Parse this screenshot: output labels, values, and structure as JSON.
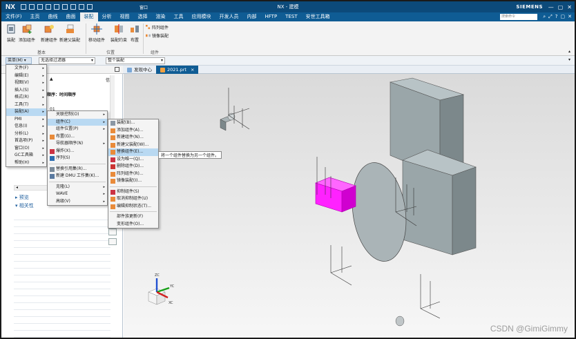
{
  "titlebar": {
    "logo": "NX",
    "title": "NX - 建模",
    "brand": "SIEMENS",
    "min": "—",
    "max": "▢",
    "close": "✕",
    "window_menu": "窗口"
  },
  "menubar": {
    "items": [
      "文件(F)",
      "主页",
      "曲线",
      "曲面",
      "装配",
      "分析",
      "视图",
      "选择",
      "渲染",
      "工具",
      "应用模块",
      "开发人员",
      "内部",
      "HFTP",
      "TEST",
      "安世工具箱"
    ],
    "active_index": 4,
    "search_placeholder": "搜索命令"
  },
  "ribbon": {
    "buttons": [
      "装配",
      "添加组件",
      "新建组件",
      "新建父装配",
      "移动组件",
      "装配约束",
      "布置"
    ],
    "small_buttons": [
      "阵列组件",
      "镜像装配"
    ],
    "groups": [
      "基本",
      "位置",
      "组件"
    ]
  },
  "toolbar2": {
    "menu_label": "菜单(M)",
    "filter": "无选择过滤器",
    "scope": "整个装配"
  },
  "tabs": {
    "items": [
      "发现中心",
      "2021.prt"
    ]
  },
  "leftpanel": {
    "col_info": "信息",
    "tree_header": "顺序：时间顺序",
    "tree_node": "01",
    "preview": "预览",
    "dependency": "相关性"
  },
  "menus": {
    "main": [
      {
        "label": "文件(F)",
        "arrow": true
      },
      {
        "label": "编辑(E)",
        "arrow": true
      },
      {
        "label": "视图(V)",
        "arrow": true
      },
      {
        "label": "插入(S)",
        "arrow": true
      },
      {
        "label": "格式(R)",
        "arrow": true
      },
      {
        "label": "工具(T)",
        "arrow": true
      },
      {
        "label": "装配(A)",
        "arrow": true
      },
      {
        "label": "PMI",
        "arrow": true
      },
      {
        "label": "信息(I)",
        "arrow": true
      },
      {
        "label": "分析(L)",
        "arrow": true
      },
      {
        "label": "首选项(P)",
        "arrow": true
      },
      {
        "label": "窗口(O)",
        "arrow": true
      },
      {
        "label": "GC工具箱",
        "arrow": true
      },
      {
        "label": "帮助(H)",
        "arrow": true
      }
    ],
    "main_highlight_index": 6,
    "assembly": [
      {
        "label": "关联控制(O)",
        "arrow": true
      },
      {
        "label": "组件(C)",
        "arrow": true
      },
      {
        "label": "组件位置(P)",
        "arrow": true
      },
      {
        "label": "布置(G)...",
        "arrow": false
      },
      {
        "label": "导航器顺序(N)",
        "arrow": true
      },
      {
        "label": "爆炸(X)...",
        "arrow": false
      },
      {
        "label": "序列(S)",
        "arrow": false
      },
      {
        "label": "替换引用集(R)...",
        "arrow": false
      },
      {
        "label": "新建 DMU 工作集(K)...",
        "arrow": false
      },
      {
        "label": "克隆(L)",
        "arrow": true
      },
      {
        "label": "WAVE",
        "arrow": true
      },
      {
        "label": "高级(V)",
        "arrow": true
      }
    ],
    "assembly_highlight_index": 1,
    "component": [
      {
        "label": "装配(B)..."
      },
      {
        "label": "添加组件(A)..."
      },
      {
        "label": "新建组件(N)..."
      },
      {
        "label": "新建父装配(W)..."
      },
      {
        "label": "替换组件(E)..."
      },
      {
        "label": "设为唯一(Q)..."
      },
      {
        "label": "删除组件(D)..."
      },
      {
        "label": "阵列组件(R)..."
      },
      {
        "label": "镜像装配(I)..."
      },
      {
        "label": "抑制组件(S)"
      },
      {
        "label": "取消抑制组件(U)"
      },
      {
        "label": "编辑抑制状态(T)..."
      },
      {
        "label": "部件族更新(F)"
      },
      {
        "label": "变形组件(O)..."
      }
    ],
    "component_highlight_index": 4,
    "tooltip": "将一个组件替换为另一个组件。"
  },
  "viewport": {
    "axis_labels": [
      "ZC",
      "YC",
      "XC"
    ],
    "watermark": "CSDN @GimiGimmy"
  },
  "colors": {
    "title": "#0c4a7a",
    "menubar": "#0f5c94",
    "highlight": "#b9d9f2",
    "part_gray": "#93a0a3",
    "magenta": "#ff22ff"
  }
}
